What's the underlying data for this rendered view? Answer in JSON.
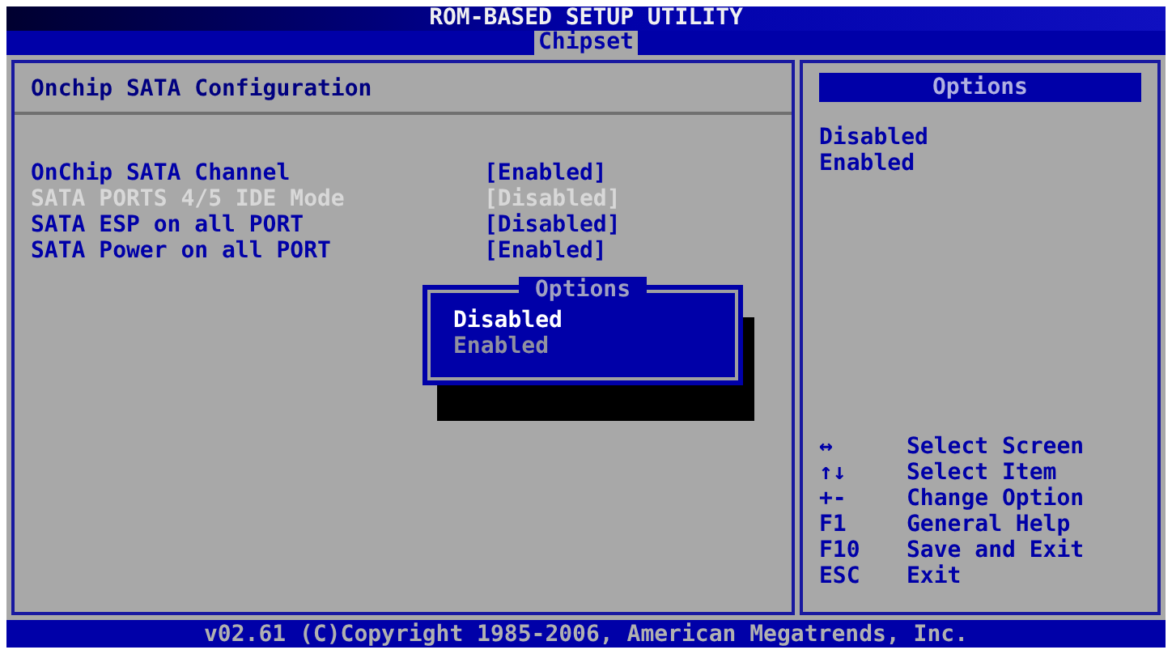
{
  "title": "ROM-BASED SETUP UTILITY",
  "tabs": [
    {
      "label": "Chipset",
      "selected": true
    }
  ],
  "section_title": "Onchip SATA Configuration",
  "settings": [
    {
      "label": "OnChip SATA Channel",
      "value": "[Enabled]",
      "disabled": false
    },
    {
      "label": "SATA PORTS 4/5 IDE Mode",
      "value": "[Disabled]",
      "disabled": true
    },
    {
      "label": "SATA ESP on all PORT",
      "value": "[Disabled]",
      "disabled": false
    },
    {
      "label": "SATA Power on all PORT",
      "value": "[Enabled]",
      "disabled": false
    }
  ],
  "help_panel": {
    "title": "Options",
    "options": [
      "Disabled",
      "Enabled"
    ],
    "keys": [
      {
        "key": "↔",
        "action": "Select Screen"
      },
      {
        "key": "↑↓",
        "action": "Select Item"
      },
      {
        "key": "+-",
        "action": "Change Option"
      },
      {
        "key": "F1",
        "action": "General Help"
      },
      {
        "key": "F10",
        "action": "Save and Exit"
      },
      {
        "key": "ESC",
        "action": "Exit"
      }
    ]
  },
  "popup": {
    "title": "Options",
    "options": [
      {
        "label": "Disabled",
        "selected": true
      },
      {
        "label": "Enabled",
        "selected": false
      }
    ]
  },
  "footer": "v02.61 (C)Copyright 1985-2006, American Megatrends, Inc."
}
